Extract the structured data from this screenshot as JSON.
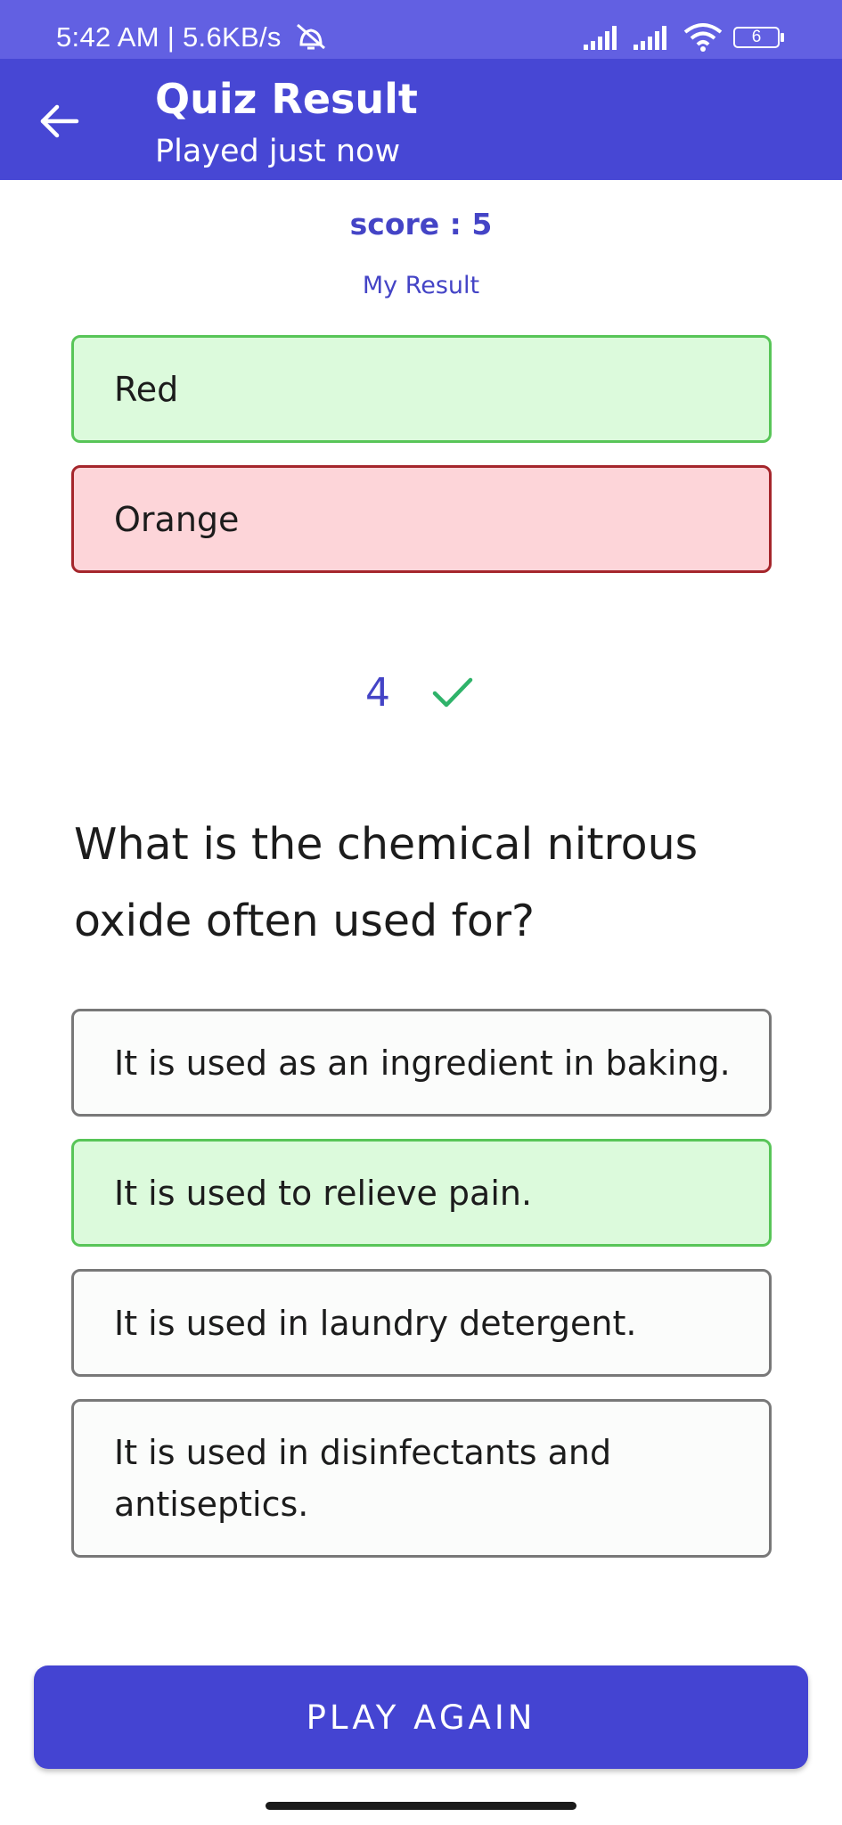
{
  "status_bar": {
    "time": "5:42 AM | 5.6KB/s",
    "battery": "6"
  },
  "app_bar": {
    "title": "Quiz Result",
    "subtitle": "Played just now"
  },
  "result": {
    "score_text": "score : 5",
    "my_result_label": "My Result"
  },
  "previous_answers": [
    {
      "label": "Red",
      "state": "correct"
    },
    {
      "label": "Orange",
      "state": "wrong"
    }
  ],
  "question": {
    "number": "4",
    "status_icon": "check-icon",
    "text": "What is the chemical nitrous oxide often used for?",
    "options": [
      {
        "label": "It is used as an ingredient in baking.",
        "state": "neutral"
      },
      {
        "label": "It is used to relieve pain.",
        "state": "correct"
      },
      {
        "label": "It is used in laundry detergent.",
        "state": "neutral"
      },
      {
        "label": "It is used in disinfectants and antiseptics.",
        "state": "neutral"
      }
    ]
  },
  "footer": {
    "play_again_label": "PLAY AGAIN"
  },
  "colors": {
    "status_bar": "#6260e2",
    "app_bar": "#4747d4",
    "accent": "#4444c6",
    "correct_bg": "#dcfadc",
    "correct_border": "#58c558",
    "wrong_bg": "#fdd5d9",
    "wrong_border": "#a5262c",
    "check": "#2fb36a"
  }
}
